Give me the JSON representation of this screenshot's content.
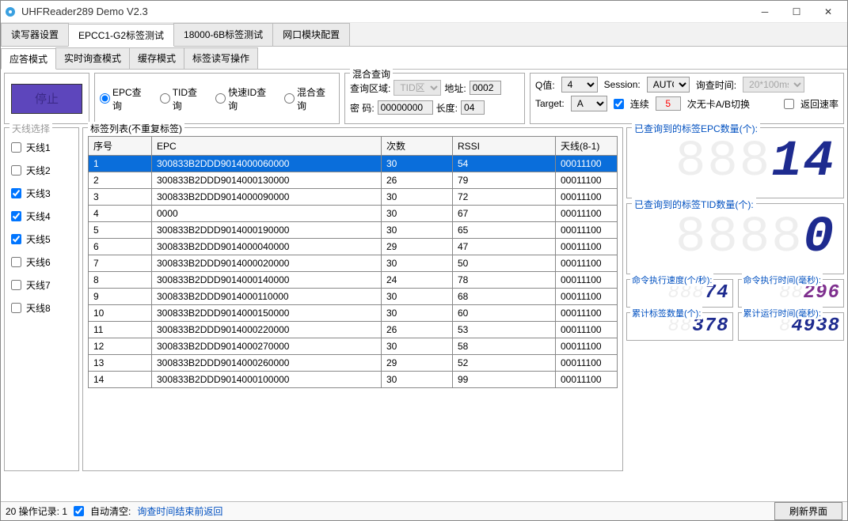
{
  "window": {
    "title": "UHFReader289 Demo V2.3"
  },
  "main_tabs": [
    "读写器设置",
    "EPCC1-G2标签测试",
    "18000-6B标签测试",
    "网口模块配置"
  ],
  "main_tab_active": 1,
  "sub_tabs": [
    "应答模式",
    "实时询查模式",
    "缓存模式",
    "标签读写操作"
  ],
  "sub_tab_active": 0,
  "stop_button": "停止",
  "query_radios": [
    "EPC查询",
    "TID查询",
    "快速ID查询",
    "混合查询"
  ],
  "mixed": {
    "legend": "混合查询",
    "area_label": "查询区域:",
    "area_value": "TID区",
    "addr_label": "地址:",
    "addr_value": "0002",
    "pwd_label": "密 码:",
    "pwd_value": "00000000",
    "len_label": "长度:",
    "len_value": "04"
  },
  "params": {
    "q_label": "Q值:",
    "q_value": "4",
    "session_label": "Session:",
    "session_value": "AUTO",
    "interval_label": "询查时间:",
    "interval_value": "20*100ms",
    "target_label": "Target:",
    "target_value": "A",
    "cont_label": "连续",
    "cont_value": "5",
    "switch_label": "次无卡A/B切换",
    "rate_label": "返回速率"
  },
  "antenna": {
    "legend": "天线选择",
    "items": [
      {
        "label": "天线1",
        "checked": false
      },
      {
        "label": "天线2",
        "checked": false
      },
      {
        "label": "天线3",
        "checked": true
      },
      {
        "label": "天线4",
        "checked": true
      },
      {
        "label": "天线5",
        "checked": true
      },
      {
        "label": "天线6",
        "checked": false
      },
      {
        "label": "天线7",
        "checked": false
      },
      {
        "label": "天线8",
        "checked": false
      }
    ]
  },
  "table": {
    "legend": "标签列表(不重复标签)",
    "headers": [
      "序号",
      "EPC",
      "次数",
      "RSSI",
      "天线(8-1)"
    ],
    "rows": [
      [
        "1",
        "300833B2DDD9014000060000",
        "30",
        "54",
        "00011100"
      ],
      [
        "2",
        "300833B2DDD9014000130000",
        "26",
        "79",
        "00011100"
      ],
      [
        "3",
        "300833B2DDD9014000090000",
        "30",
        "72",
        "00011100"
      ],
      [
        "4",
        "0000",
        "30",
        "67",
        "00011100"
      ],
      [
        "5",
        "300833B2DDD9014000190000",
        "30",
        "65",
        "00011100"
      ],
      [
        "6",
        "300833B2DDD9014000040000",
        "29",
        "47",
        "00011100"
      ],
      [
        "7",
        "300833B2DDD9014000020000",
        "30",
        "50",
        "00011100"
      ],
      [
        "8",
        "300833B2DDD9014000140000",
        "24",
        "78",
        "00011100"
      ],
      [
        "9",
        "300833B2DDD9014000110000",
        "30",
        "68",
        "00011100"
      ],
      [
        "10",
        "300833B2DDD9014000150000",
        "30",
        "60",
        "00011100"
      ],
      [
        "11",
        "300833B2DDD9014000220000",
        "26",
        "53",
        "00011100"
      ],
      [
        "12",
        "300833B2DDD9014000270000",
        "30",
        "58",
        "00011100"
      ],
      [
        "13",
        "300833B2DDD9014000260000",
        "29",
        "52",
        "00011100"
      ],
      [
        "14",
        "300833B2DDD9014000100000",
        "30",
        "99",
        "00011100"
      ]
    ],
    "selected": 0
  },
  "stats": {
    "epc_label": "已查询到的标签EPC数量(个):",
    "epc_value": "14",
    "tid_label": "已查询到的标签TID数量(个):",
    "tid_value": "0",
    "speed_label": "命令执行速度(个/秒):",
    "speed_value": "74",
    "time_label": "命令执行时间(毫秒):",
    "time_value": "296",
    "total_label": "累计标签数量(个):",
    "total_value": "378",
    "runtime_label": "累计运行时间(毫秒):",
    "runtime_value": "4938"
  },
  "bottom": {
    "prefix": "20 操作记录: 1",
    "autoclear": "自动清空:",
    "msg": "询查时间结束前返回",
    "refresh": "刷新界面"
  }
}
